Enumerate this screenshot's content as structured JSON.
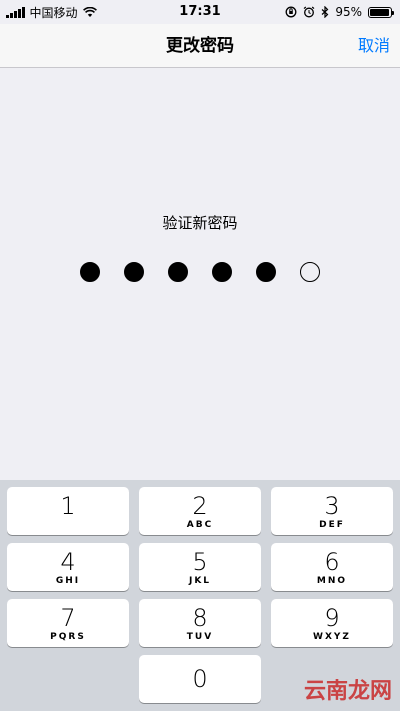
{
  "status_bar": {
    "carrier": "中国移动",
    "time": "17:31",
    "battery_percent": "95%",
    "battery_level": 0.95
  },
  "nav": {
    "title": "更改密码",
    "cancel_label": "取消"
  },
  "passcode": {
    "prompt": "验证新密码",
    "entered_count": 5,
    "total_count": 6
  },
  "keypad": {
    "keys": [
      {
        "num": "1",
        "letters": ""
      },
      {
        "num": "2",
        "letters": "ABC"
      },
      {
        "num": "3",
        "letters": "DEF"
      },
      {
        "num": "4",
        "letters": "GHI"
      },
      {
        "num": "5",
        "letters": "JKL"
      },
      {
        "num": "6",
        "letters": "MNO"
      },
      {
        "num": "7",
        "letters": "PQRS"
      },
      {
        "num": "8",
        "letters": "TUV"
      },
      {
        "num": "9",
        "letters": "WXYZ"
      },
      {
        "num": "0",
        "letters": ""
      }
    ]
  },
  "watermark": "云南龙网"
}
